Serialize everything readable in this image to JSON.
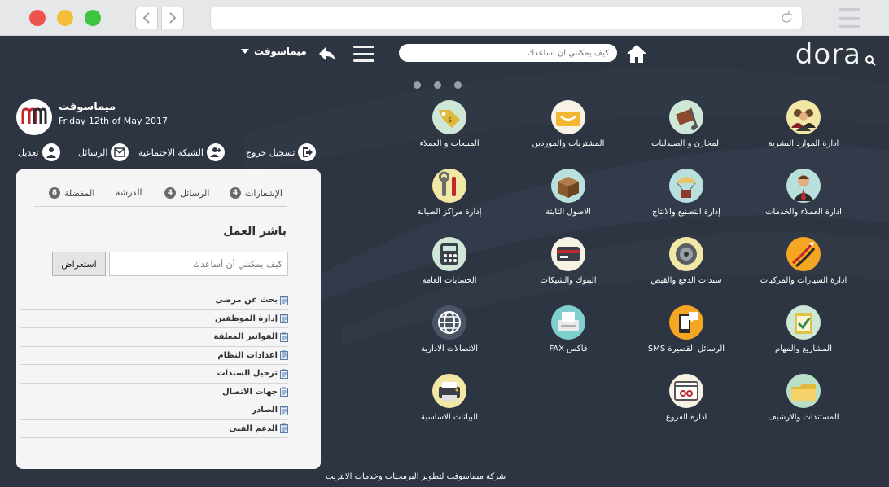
{
  "chrome": {
    "back_icon": "chevron-left-icon",
    "forward_icon": "chevron-right-icon",
    "reload_icon": "reload-icon"
  },
  "header": {
    "logo": "dora",
    "search_placeholder": "كيف يمكنني أن أساعدك",
    "company": "ميماسوفت"
  },
  "profile": {
    "name": "ميماسوفت",
    "date": "Friday 12th of May 2017",
    "actions": {
      "logout": "تسجيل خروج",
      "social": "الشبكة الاجتماعية",
      "messages": "الرسائل",
      "edit": "تعديل"
    }
  },
  "panel": {
    "tabs": [
      {
        "label": "الإشعارات",
        "count": "4"
      },
      {
        "label": "الرسائل",
        "count": "4"
      },
      {
        "label": "الدرشة",
        "count": ""
      },
      {
        "label": "المفضلة",
        "count": "8"
      }
    ],
    "title": "باشر العمل",
    "search_placeholder": "كيف يمكنني أن أساعدك",
    "button_label": "استعراض",
    "links": [
      "بحث عن مرضى",
      "إدارة الموظفين",
      "الفواتير المعلقة",
      "اعدادات النظام",
      "ترحيل السندات",
      "جهات الاتصال",
      "الصادر",
      "الدعم الفنى"
    ]
  },
  "modules": [
    {
      "label": "ادارة الموارد البشرية",
      "icon": "people-icon",
      "color": "#f2e8a5"
    },
    {
      "label": "المخازن و الصيدليات",
      "icon": "warehouse-cart-icon",
      "color": "#cfe7d6"
    },
    {
      "label": "المشتريات والموردين",
      "icon": "shopping-basket-icon",
      "color": "#f7f2e4"
    },
    {
      "label": "المبيعات و العملاء",
      "icon": "price-tag-icon",
      "color": "#cfe7d6"
    },
    {
      "label": "ادارة العملاء والخدمات",
      "icon": "customer-service-icon",
      "color": "#b8e0dd"
    },
    {
      "label": "إدارة التصنيع والانتاج",
      "icon": "parachute-box-icon",
      "color": "#b8e0dd"
    },
    {
      "label": "الاصول الثابتة",
      "icon": "box-icon",
      "color": "#b8e0dd"
    },
    {
      "label": "إدارة مراكز الصيانة",
      "icon": "tools-icon",
      "color": "#f2e8a5"
    },
    {
      "label": "ادارة السيارات والمركبات",
      "icon": "jumper-cables-icon",
      "color": "#f5a623"
    },
    {
      "label": "سندات الدفع والقبض",
      "icon": "vault-dial-icon",
      "color": "#f2e8a5"
    },
    {
      "label": "البنوك والشيكات",
      "icon": "credit-card-icon",
      "color": "#f7f2e4"
    },
    {
      "label": "الحسابات العامة",
      "icon": "calculator-icon",
      "color": "#cfe7d6"
    },
    {
      "label": "المشاريع والمهام",
      "icon": "checklist-icon",
      "color": "#cfe7d6"
    },
    {
      "label": "الرسائل القصيرة SMS",
      "icon": "sms-phone-icon",
      "color": "#f5a623"
    },
    {
      "label": "فاكس FAX",
      "icon": "fax-icon",
      "color": "#7fcfcf"
    },
    {
      "label": "الاتصالات الادارية",
      "icon": "globe-icon",
      "color": "#4a5566"
    },
    {
      "label": "المستندات والارشيف",
      "icon": "folder-icon",
      "color": "#b8e0c8"
    },
    {
      "label": "ادارة الفروع",
      "icon": "branch-window-icon",
      "color": "#f7f2e4"
    },
    {
      "label": "البيانات الاساسية",
      "icon": "printer-icon",
      "color": "#f2e8a5"
    }
  ],
  "footer": "شركة ميماسوفت لتطوير البرمجيات وخدمات الانترنت"
}
